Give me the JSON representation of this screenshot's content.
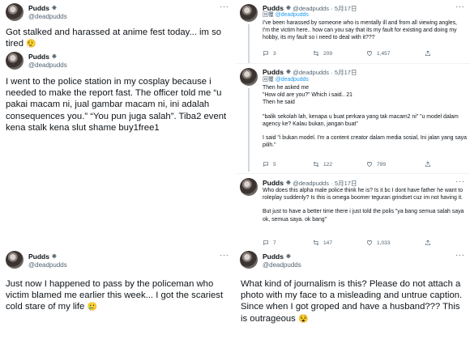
{
  "verified_glyph": "❉",
  "more_glyph": "···",
  "left": {
    "tweet1": {
      "name": "Pudds",
      "handle": "@deadpudds",
      "text": "Got stalked and harassed at anime fest today... im so tired",
      "emoji": "😮‍💨"
    },
    "tweet2": {
      "name": "Pudds",
      "handle": "@deadpudds",
      "text": "I went to the police station in my cosplay because i needed to make the report fast. The officer told me “u pakai macam ni, jual gambar macam ni, ini adalah consequences you.” “You pun juga salah”. Tiba2 event kena stalk kena slut shame buy1free1"
    },
    "tweet3": {
      "name": "Pudds",
      "handle": "@deadpudds",
      "text": "Just now I happened to pass by the policeman who victim blamed me earlier this week... I got the scariest cold stare of my life",
      "emoji": "🥲"
    }
  },
  "right": {
    "reply1": {
      "name": "Pudds",
      "handle": "@deadpudds",
      "date": "· 5月17日",
      "reply_to_label": "回覆",
      "reply_to_handle": "@deadpudds",
      "text": "I've been harassed by someone who is mentally ill and from all viewing angles, I'm the victim here.. how can you say that its my fault for existing and doing my hobby, its my fault so i need to deal with it???",
      "counts": {
        "replies": "3",
        "retweets": "209",
        "likes": "1,457"
      }
    },
    "reply2": {
      "name": "Pudds",
      "handle": "@deadpudds",
      "date": "· 5月17日",
      "reply_to_label": "回覆",
      "reply_to_handle": "@deadpudds",
      "lines": [
        "Then he asked me",
        "\"How old are you?\" Which i said.. 21",
        "Then he said",
        "",
        "\"balik sekolah lah, kenapa u buat perkara yang tak macam2 ni\" \"u model dalam agency ke? Kalau bukan, jangan buat\"",
        "",
        "I said \"i bukan model. I'm a content creator dalam media sosial, Ini jalan yang saya pilih.\""
      ],
      "counts": {
        "replies": "5",
        "retweets": "122",
        "likes": "799"
      }
    },
    "reply3": {
      "name": "Pudds",
      "handle": "@deadpudds",
      "date": "· 5月17日",
      "lines": [
        "Who does this alpha male police think he is? Is it bc I dont have father he want to roleplay suddenly? Is this is omega boomer teguran grindset cuz im not having it.",
        "",
        "But just to have a better time there i just told the polis \"ya bang semua salah saya ok, semua saya. ok bang\""
      ],
      "counts": {
        "replies": "7",
        "retweets": "147",
        "likes": "1,033"
      }
    },
    "tweet4": {
      "name": "Pudds",
      "handle": "@deadpudds",
      "text": "What kind of journalism is this? Please do not attach a photo with my face to a misleading and untrue caption. Since when I got groped and have a husband??? This is outrageous",
      "emoji": "😵"
    }
  }
}
